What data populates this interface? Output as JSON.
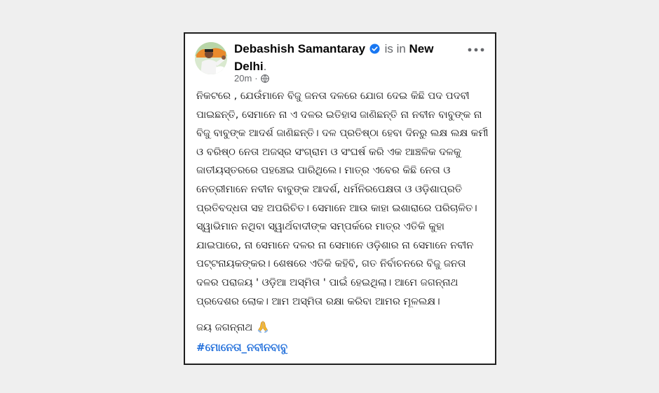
{
  "post": {
    "author": "Debashish Samantaray",
    "connector": "is in",
    "location": "New Delhi",
    "location_suffix": ".",
    "time": "20m",
    "separator": "·",
    "privacy_icon": "globe-icon",
    "verified_icon": "verified-badge-icon",
    "more_icon": "more-options-icon",
    "body": "ନିକଟରେ , ଯେଉଁମାନେ ବିଜୁ ଜନତା ଦଳରେ ଯୋଗ ଦେଇ କିଛି ପଦ ପଦବୀ ପାଇଛନ୍ତି, ସେମାନେ ନା ଏ ଦଳର ଇତିହାସ ଜାଣିଛନ୍ତି ନା ନବୀନ ବାବୁଙ୍କ ନା ବିଜୁ ବାବୁଙ୍କ ଆଦର୍ଶ ଜାଣିଛନ୍ତି। ଦଳ ପ୍ରତିଷ୍ଠା ହେବା ଦିନରୁ ଲକ୍ଷ ଲକ୍ଷ କର୍ମୀ ଓ ବରିଷ୍ଠ ନେତା ଅଜସ୍ର ସଂଗ୍ରାମ ଓ ସଂଘର୍ଷ କରି ଏକ ଆଞ୍ଚଳିକ ଦଳକୁ ଜାତୀୟସ୍ତରରେ ପହଞ୍ଚେଇ ପାରିଥିଲେ। ମାତ୍ର ଏବେର କିଛି ନେତା ଓ ନେତ୍ରୀମାନେ ନବୀନ ବାବୁଙ୍କ ଆଦର୍ଶ, ଧର୍ମନିରପେକ୍ଷତା ଓ ଓଡ଼ିଶାପ୍ରତି ପ୍ରତିବଦ୍ଧତା ସହ ଅପରିଚିତ। ସେମାନେ ଆଉ କାହା ଇଶାରାରେ ପରିଚାଳିତ। ସ୍ୱାଭିମାନ ନଥିବା ସ୍ୱାର୍ଥବାଦୀଙ୍କ ସମ୍ପର୍କରେ ମାତ୍ର ଏତିକି କୁହା ଯାଇପାରେ, ନା ସେମାନେ ଦଳର ନା ସେମାନେ ଓଡ଼ିଶାର ନା ସେମାନେ ନବୀନ ପଟ୍ଟନାୟକଙ୍କର। ଶେଷରେ ଏତିକି କହିବି, ଗତ ନିର୍ବାଚନରେ ବିଜୁ ଜନତା ଦଳର ପରାଜୟ ' ଓଡ଼ିଆ ଅସ୍ମିତା ' ପାଇଁ ହେଇଥିଲା। ଆମେ ଜଗନ୍ନାଥ ପ୍ରଦେଶର ଲୋକ। ଆମ ଅସ୍ମିତା ରକ୍ଷା କରିବା ଆମର ମୂଳଲକ୍ଷ।",
    "sign_off": "ଜୟ ଜଗନ୍ନାଥ",
    "sign_off_icon": "folded-hands-icon",
    "hashtag": "#ମୋନେତା_ନବୀନବାବୁ"
  },
  "colors": {
    "page_background": "#efefef",
    "card_background": "#ffffff",
    "card_border": "#1f1f1f",
    "text_primary": "#050505",
    "text_secondary": "#65676b",
    "hashtag": "#216fdb",
    "verified": "#1877f2"
  }
}
